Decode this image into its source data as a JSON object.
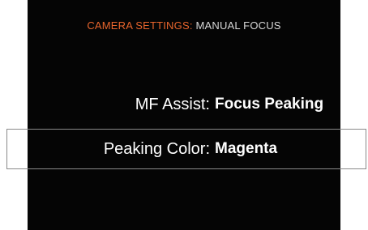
{
  "header": {
    "category": "CAMERA SETTINGS:",
    "page": "MANUAL FOCUS"
  },
  "settings": [
    {
      "label": "MF Assist:",
      "value": "Focus Peaking",
      "selected": false
    },
    {
      "label": "Peaking Color:",
      "value": "Magenta",
      "selected": true
    }
  ],
  "colors": {
    "screen_background": "#050505",
    "header_accent": "#e8652d",
    "header_text": "#d8d8d8",
    "text": "#ffffff",
    "selection_border": "#8a8a8a"
  }
}
